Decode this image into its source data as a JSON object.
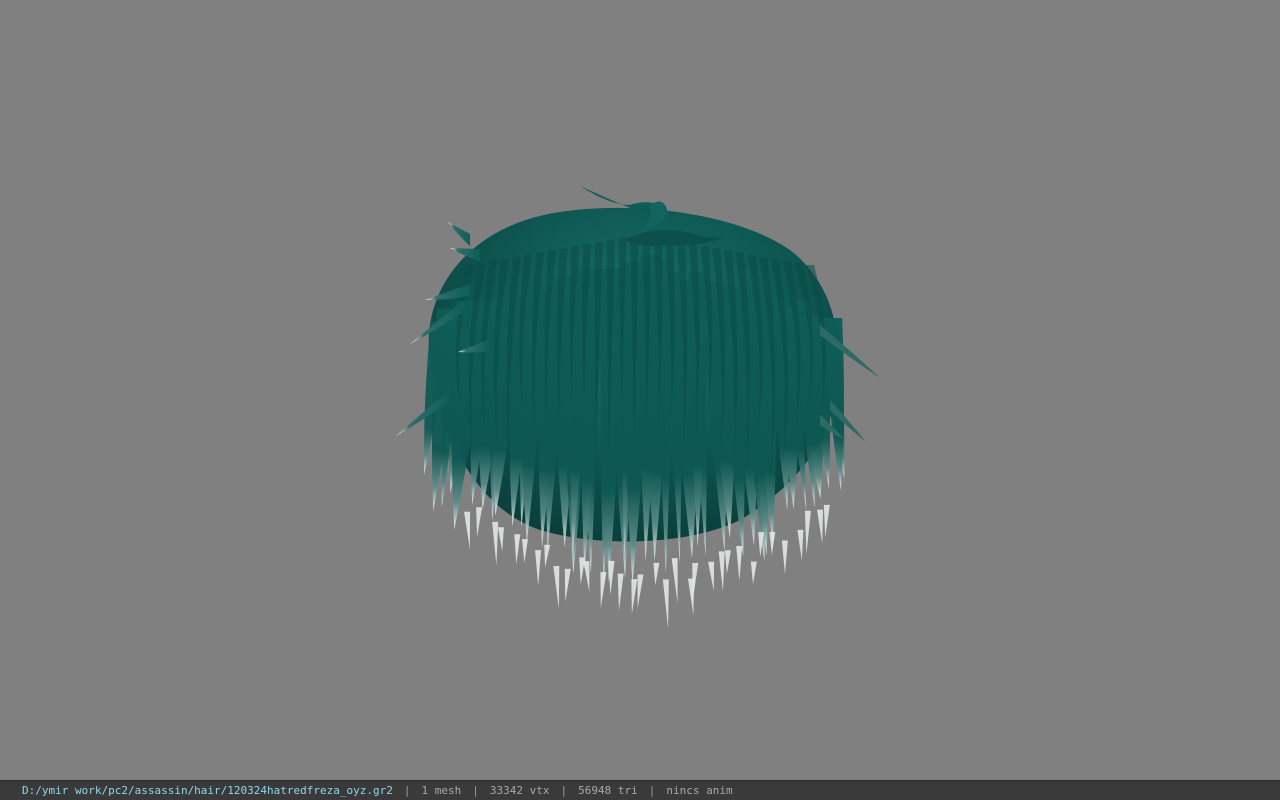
{
  "viewport": {
    "background": "#808080",
    "model": {
      "description_icon": "hair-mesh",
      "hair_color": "#0f5a55",
      "tip_color": "#e6e9e8"
    }
  },
  "status": {
    "file_path": "D:/ymir work/pc2/assassin/hair/120324hatredfreza_oyz.gr2",
    "separator": "|",
    "mesh": "1 mesh",
    "vertices": "33342 vtx",
    "triangles": "56948 tri",
    "anim": "nincs anim"
  }
}
